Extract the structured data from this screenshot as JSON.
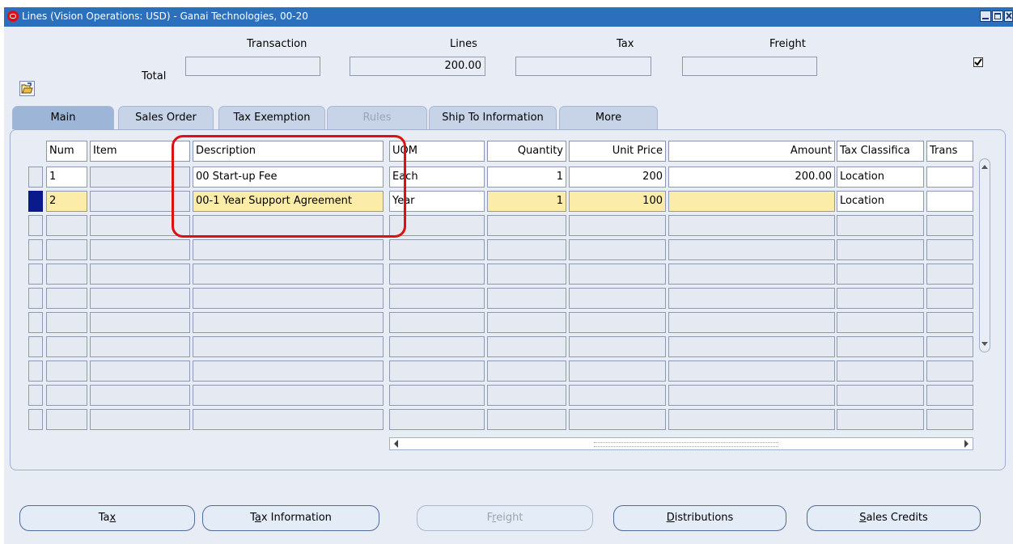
{
  "window": {
    "title": "Lines (Vision Operations: USD) - Ganai Technologies, 00-20"
  },
  "totals": {
    "label": "Total",
    "transaction_label": "Transaction",
    "lines_label": "Lines",
    "tax_label": "Tax",
    "freight_label": "Freight",
    "transaction_value": "",
    "lines_value": "200.00",
    "tax_value": "",
    "freight_value": "",
    "checkbox_checked": true
  },
  "tabs": [
    {
      "label": "Main",
      "active": true,
      "disabled": false
    },
    {
      "label": "Sales Order",
      "active": false,
      "disabled": false
    },
    {
      "label": "Tax Exemption",
      "active": false,
      "disabled": false
    },
    {
      "label": "Rules",
      "active": false,
      "disabled": true
    },
    {
      "label": "Ship To Information",
      "active": false,
      "disabled": false
    },
    {
      "label": "More",
      "active": false,
      "disabled": false
    }
  ],
  "grid": {
    "columns": [
      "Num",
      "Item",
      "Description",
      "UOM",
      "Quantity",
      "Unit Price",
      "Amount",
      "Tax Classifica",
      "Trans"
    ],
    "rows": [
      {
        "num": "1",
        "item": "",
        "description": "00 Start-up Fee",
        "uom": "Each",
        "quantity": "1",
        "unit_price": "200",
        "amount": "200.00",
        "tax_class": "Location",
        "trans": ""
      },
      {
        "num": "2",
        "item": "",
        "description": "00-1 Year Support Agreement",
        "uom": "Year",
        "quantity": "1",
        "unit_price": "100",
        "amount": "",
        "tax_class": "Location",
        "trans": ""
      }
    ]
  },
  "buttons": {
    "tax": "Tax",
    "tax_information": "Tax Information",
    "freight": "Freight",
    "distributions": "Distributions",
    "sales_credits": "Sales Credits"
  },
  "colors": {
    "titlebar": "#2c6fbd",
    "highlight_box": "#e01010",
    "current_row": "#fcecaa",
    "row_indicator": "#0b1a8a"
  }
}
